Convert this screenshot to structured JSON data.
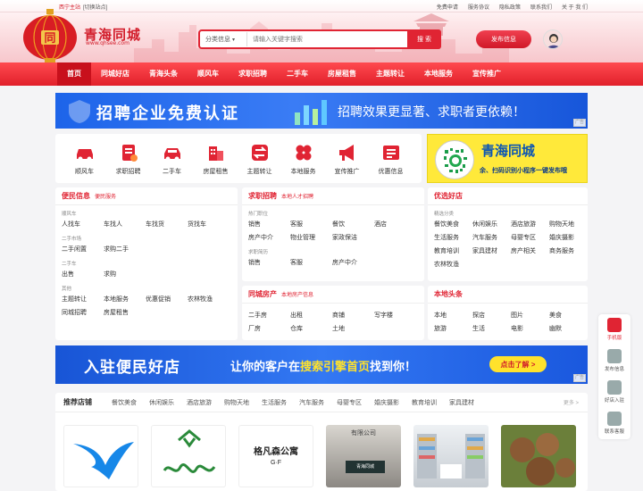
{
  "topbar": {
    "site": "西宁主站",
    "switch": "[切换站点]",
    "links": [
      "免费申请",
      "服务协议",
      "隐私政策",
      "联系我们",
      "关 于 我 们"
    ]
  },
  "logo": {
    "lantern_char": "同",
    "name": "青海同城",
    "domain": "www.qhsee.com"
  },
  "search": {
    "category": "分类信息",
    "placeholder": "请输入关键字搜索",
    "button": "搜 索"
  },
  "post_button": "发布信息",
  "nav": [
    "首页",
    "同城好店",
    "青海头条",
    "顺风车",
    "求职招聘",
    "二手车",
    "房屋租售",
    "主题转让",
    "本地服务",
    "宣传推广"
  ],
  "banner1": {
    "title": "招聘企业免费认证",
    "slogan": "招聘效果更显著、求职者更依赖！",
    "ad": "广告"
  },
  "quick_icons": [
    {
      "label": "顺风车",
      "icon": "car-icon"
    },
    {
      "label": "求职招聘",
      "icon": "resume-icon"
    },
    {
      "label": "二手车",
      "icon": "used-car-icon"
    },
    {
      "label": "房屋租售",
      "icon": "building-icon"
    },
    {
      "label": "主题转让",
      "icon": "transfer-icon"
    },
    {
      "label": "本地服务",
      "icon": "clover-icon"
    },
    {
      "label": "宣传推广",
      "icon": "megaphone-icon"
    },
    {
      "label": "优惠信息",
      "icon": "ticket-icon"
    }
  ],
  "qr": {
    "brand": "青海同城",
    "note": "余、扫码识别小程序一键发布哦"
  },
  "sections": {
    "minsheng": {
      "title": "便民信息",
      "tag": "便民服务",
      "groups": [
        {
          "sub": "顺风车",
          "items": [
            "人找车",
            "车找人",
            "车找货",
            "货找车"
          ]
        },
        {
          "sub": "二手市场",
          "items": [
            "二手闲置",
            "求购二手"
          ]
        },
        {
          "sub": "二手车",
          "items": [
            "出售",
            "求购"
          ]
        },
        {
          "sub": "其他",
          "items": [
            "主题转让",
            "本地服务",
            "优惠促销",
            "农林牧渔",
            "同城招聘",
            "房屋租售"
          ]
        }
      ]
    },
    "zhaopin": {
      "title": "求职招聘",
      "tag": "本地人才招聘",
      "groups": [
        {
          "sub": "热门职位",
          "items": [
            "销售",
            "客服",
            "餐饮",
            "酒店",
            "房产中介",
            "物业管理",
            "家政保洁"
          ]
        },
        {
          "sub": "求职简历",
          "items": [
            "销售",
            "客服",
            "房产中介"
          ]
        }
      ]
    },
    "haodian": {
      "title": "优选好店",
      "groups": [
        {
          "sub": "精选分类",
          "items": [
            "餐饮美食",
            "休闲娱乐",
            "酒店旅游",
            "购物天地",
            "生活服务",
            "汽车服务",
            "母婴专区",
            "婚庆摄影",
            "教育培训",
            "家具建材",
            "房产相关",
            "商务服务",
            "农林牧渔"
          ]
        }
      ]
    },
    "fangchan": {
      "title": "同城房产",
      "tag": "本地房产信息",
      "items": [
        "二手房",
        "出租",
        "商铺",
        "写字楼",
        "厂房",
        "仓库",
        "土地"
      ]
    },
    "toutiao": {
      "title": "本地头条",
      "items": [
        "本地",
        "探店",
        "图片",
        "美食",
        "旅游",
        "生活",
        "电影",
        "幽默"
      ]
    }
  },
  "banner2": {
    "title": "入驻便民好店",
    "slogan_pre": "让你的客户在",
    "slogan_hl": "搜索引擎首页",
    "slogan_post": "找到你！",
    "button": "点击了解 >",
    "ad": "广告"
  },
  "shops": {
    "title": "推荐店铺",
    "cats": [
      "餐饮美食",
      "休闲娱乐",
      "酒店旅游",
      "购物天地",
      "生活服务",
      "汽车服务",
      "母婴专区",
      "婚庆摄影",
      "教育培训",
      "家具建材"
    ],
    "more": "更多 >",
    "texts": {
      "s3": "格凡森公寓",
      "s3sub": "G·F",
      "s4": "有限公司",
      "s4sub": "青海同城"
    }
  },
  "sidebar": [
    "手机版",
    "发布信息",
    "好店入驻",
    "联系客服"
  ]
}
